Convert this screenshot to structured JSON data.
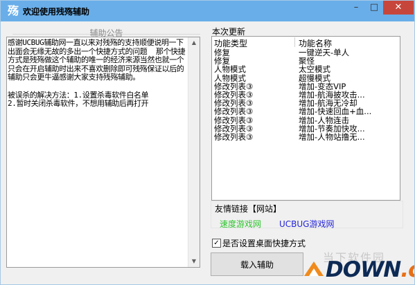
{
  "window": {
    "title": "欢迎使用残殇辅助",
    "app_icon_char": "殇",
    "minimize_glyph": "–",
    "maximize_glyph": "□",
    "close_glyph": "✕"
  },
  "notice": {
    "legend": "辅助公告",
    "text": "感谢UCBUG辅助网一直以来对残殇的支持顺便说明一下出面会无缘无故的多出一个快捷方式的问题  那个快捷方式是残殇做这个辅助的唯一的经济来源当然也就一个只会在开启辅助时出来不喜欢删除即可残殇保证以后的辅助只会更牛逼感谢大家支持残殇辅助。\n\n被误杀的解决方法：1.设置杀毒软件白名单\n2.暂时关闭杀毒软件，不想用辅助后再打开"
  },
  "updates": {
    "title": "本次更新",
    "columns": [
      "功能类型",
      "功能名称"
    ],
    "rows": [
      {
        "type": "修复",
        "name": "一键逆天-单人"
      },
      {
        "type": "修复",
        "name": "聚怪"
      },
      {
        "type": "人物模式",
        "name": "太空模式"
      },
      {
        "type": "人物模式",
        "name": "超慢模式"
      },
      {
        "type": "修改列表③",
        "name": "增加-变态VIP"
      },
      {
        "type": "修改列表③",
        "name": "增加-航海披攻击..."
      },
      {
        "type": "修改列表③",
        "name": "增加-航海无冷却"
      },
      {
        "type": "修改列表③",
        "name": "增加-快速回血+血..."
      },
      {
        "type": "修改列表③",
        "name": "增加-人物连击"
      },
      {
        "type": "修改列表③",
        "name": "增加-节奏加快攻..."
      },
      {
        "type": "修改列表③",
        "name": "增加-人物站撸无..."
      }
    ]
  },
  "links": {
    "title": "友情链接【网站】",
    "green_link": "速度游戏网",
    "blue_link": "UCBUG游戏网"
  },
  "shortcut_checkbox": {
    "label": "是否设置桌面快捷方式",
    "checked": true,
    "check_glyph": "✓"
  },
  "load_button_label": "载入辅助",
  "watermark": {
    "faint_text": "当下软件园",
    "brand_main": "DOWN",
    "brand_suffix": ".cc"
  },
  "colors": {
    "titlebar": "#69aee9",
    "close_button": "#c7463b",
    "link_green": "#2fc42f",
    "link_blue": "#2323d8"
  }
}
